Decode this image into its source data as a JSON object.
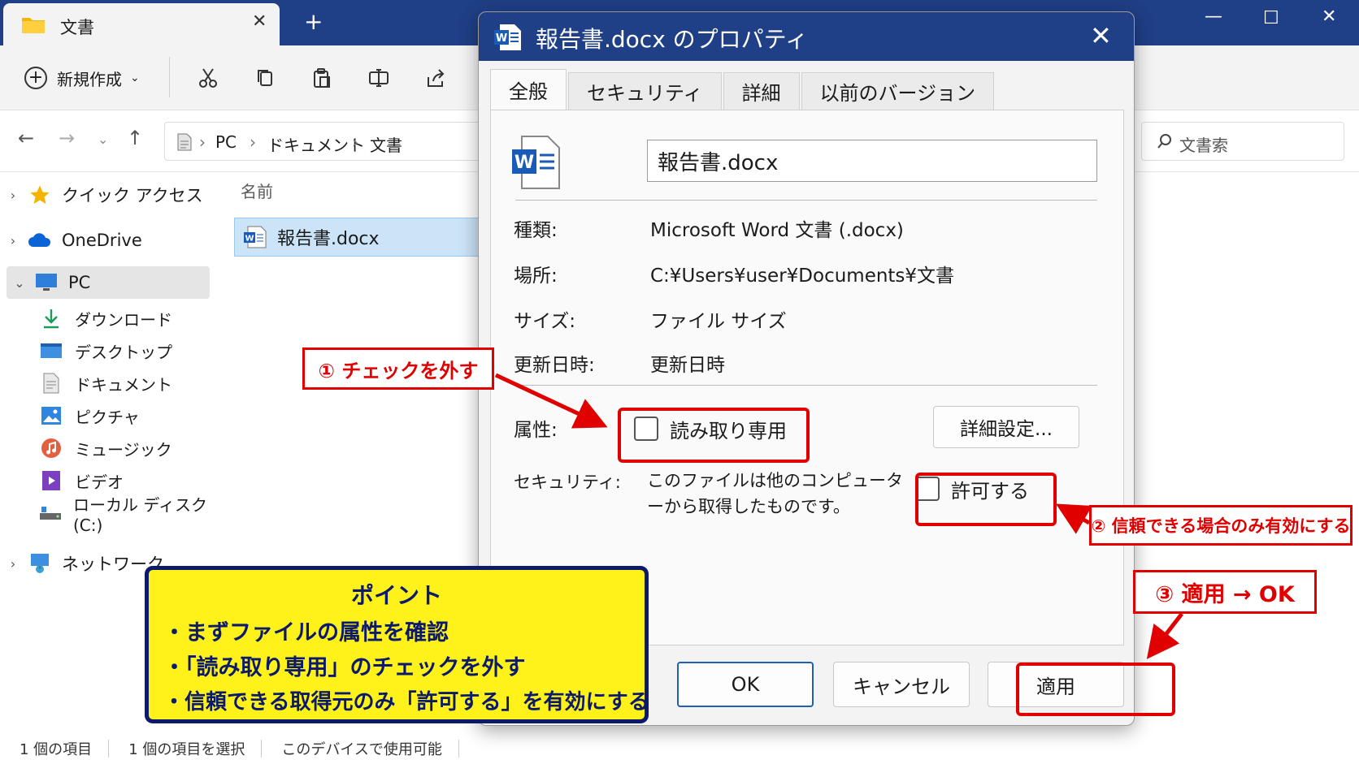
{
  "explorer": {
    "tab_title": "文書",
    "toolbar": {
      "new_label": "新規作成"
    },
    "breadcrumb": [
      "PC",
      "ドキュメント",
      "文書"
    ],
    "search_placeholder": "文書索",
    "sidebar": {
      "quick_access": "クイック アクセス",
      "onedrive": "OneDrive",
      "pc": "PC",
      "sub_items": [
        "ダウンロード",
        "デスクトップ",
        "ドキュメント",
        "ピクチャ",
        "ミュージック",
        "ビデオ",
        "ローカル ディスク (C:)"
      ],
      "network": "ネットワーク"
    },
    "column_name": "名前",
    "file_name": "報告書.docx",
    "status": {
      "count": "1 個の項目",
      "selected": "1 個の項目を選択",
      "availability": "このデバイスで使用可能"
    }
  },
  "dialog": {
    "title": "報告書.docx のプロパティ",
    "tabs": [
      "全般",
      "セキュリティ",
      "詳細",
      "以前のバージョン"
    ],
    "filename": "報告書.docx",
    "type_label": "種類:",
    "type_value": "Microsoft Word 文書 (.docx)",
    "location_label": "場所:",
    "location_value": "C:¥Users¥user¥Documents¥文書",
    "size_label": "サイズ:",
    "size_value": "ファイル サイズ",
    "modified_label": "更新日時:",
    "modified_value": "更新日時",
    "attributes_label": "属性:",
    "readonly_label": "読み取り専用",
    "advanced_button": "詳細設定...",
    "security_label": "セキュリティ:",
    "security_text": "このファイルは他のコンピューターから取得したものです。",
    "allow_label": "許可する",
    "buttons": {
      "ok": "OK",
      "cancel": "キャンセル",
      "apply": "適用"
    }
  },
  "annotations": {
    "step1": "① チェックを外す",
    "step2": "② 信頼できる場合のみ有効にする",
    "step3": "③ 適用 → OK",
    "point_title": "ポイント",
    "point_lines": [
      "・まずファイルの属性を確認",
      "・「読み取り専用」のチェックを外す",
      "・信頼できる取得元のみ「許可する」を有効にする"
    ],
    "highlight_color": "#e00000",
    "point_bg": "#fff21a"
  },
  "colors": {
    "titlebar": "#1f3f86",
    "selection": "#cce4f7",
    "accent": "#1f5fb6"
  }
}
